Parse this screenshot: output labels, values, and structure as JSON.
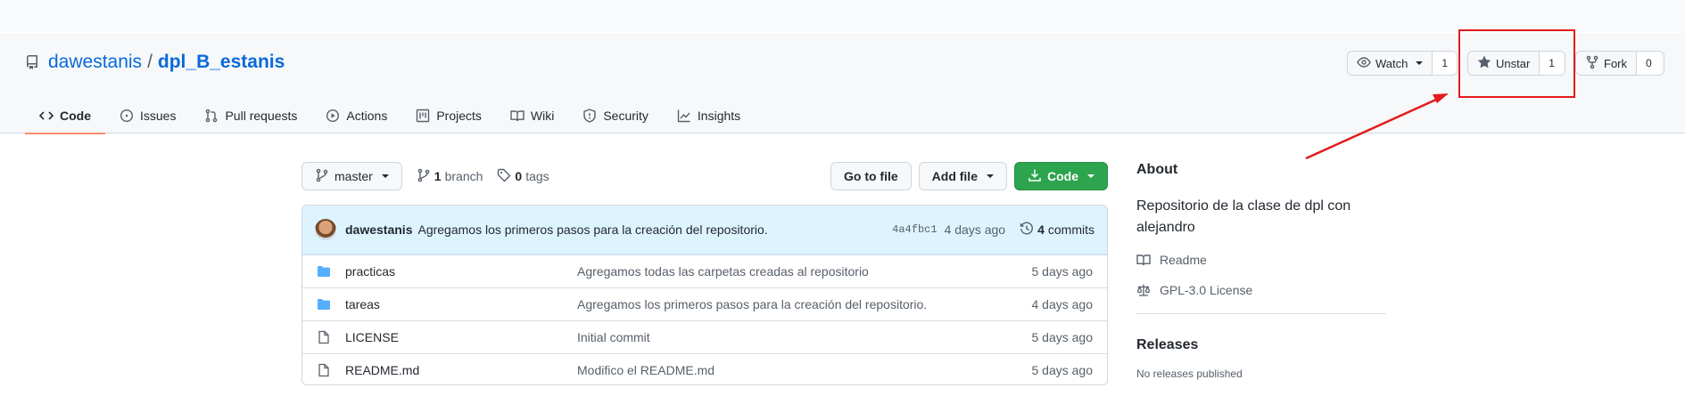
{
  "repo": {
    "owner": "dawestanis",
    "separator": "/",
    "name": "dpl_B_estanis"
  },
  "header_actions": {
    "watch": {
      "label": "Watch",
      "count": "1"
    },
    "star": {
      "label": "Unstar",
      "count": "1"
    },
    "fork": {
      "label": "Fork",
      "count": "0"
    }
  },
  "tabs": [
    {
      "label": "Code",
      "icon": "code-icon",
      "active": true
    },
    {
      "label": "Issues",
      "icon": "issue-icon"
    },
    {
      "label": "Pull requests",
      "icon": "pull-request-icon"
    },
    {
      "label": "Actions",
      "icon": "play-icon"
    },
    {
      "label": "Projects",
      "icon": "project-icon"
    },
    {
      "label": "Wiki",
      "icon": "book-icon"
    },
    {
      "label": "Security",
      "icon": "shield-icon"
    },
    {
      "label": "Insights",
      "icon": "graph-icon"
    }
  ],
  "branchbar": {
    "branch": "master",
    "branch_count": "1",
    "branch_label": "branch",
    "tag_count": "0",
    "tag_label": "tags",
    "go_to_file": "Go to file",
    "add_file": "Add file",
    "code": "Code"
  },
  "latest_commit": {
    "author": "dawestanis",
    "message": "Agregamos los primeros pasos para la creación del repositorio.",
    "sha": "4a4fbc1",
    "age": "4 days ago",
    "commit_count": "4",
    "commit_label": "commits"
  },
  "files": [
    {
      "type": "folder",
      "name": "practicas",
      "message": "Agregamos todas las carpetas creadas al repositorio",
      "age": "5 days ago"
    },
    {
      "type": "folder",
      "name": "tareas",
      "message": "Agregamos los primeros pasos para la creación del repositorio.",
      "age": "4 days ago"
    },
    {
      "type": "file",
      "name": "LICENSE",
      "message": "Initial commit",
      "age": "5 days ago"
    },
    {
      "type": "file",
      "name": "README.md",
      "message": "Modifico el README.md",
      "age": "5 days ago"
    }
  ],
  "about": {
    "heading": "About",
    "description": "Repositorio de la clase de dpl con alejandro",
    "readme": "Readme",
    "license": "GPL-3.0 License"
  },
  "releases": {
    "heading": "Releases",
    "subtitle": "No releases published"
  },
  "colors": {
    "accent": "#0969da",
    "green": "#2da44e",
    "annotation": "#e31b1b",
    "tab_underline": "#fd8c73"
  }
}
